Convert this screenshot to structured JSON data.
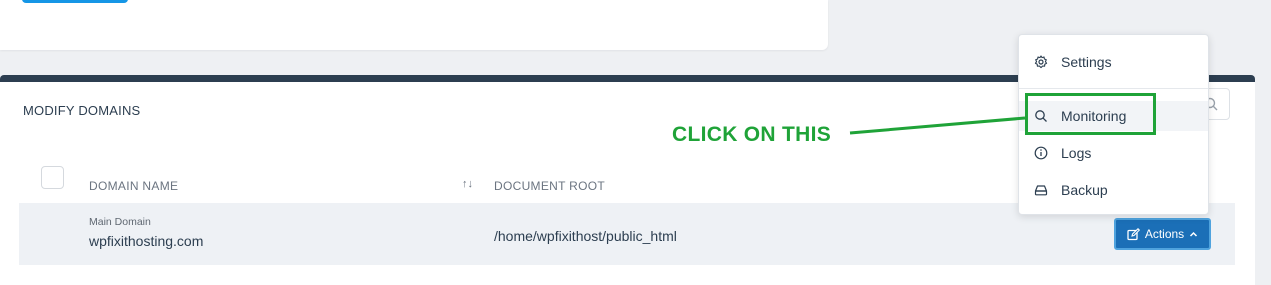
{
  "panel": {
    "title": "MODIFY DOMAINS"
  },
  "table": {
    "columns": {
      "domain_name": "DOMAIN NAME",
      "sort_glyph": "↑↓",
      "document_root": "DOCUMENT ROOT"
    },
    "rows": [
      {
        "label": "Main Domain",
        "domain": "wpfixithosting.com",
        "document_root": "/home/wpfixithost/public_html",
        "actions_label": "Actions"
      }
    ]
  },
  "menu": {
    "items": [
      {
        "label": "Settings",
        "icon": "gear-icon"
      },
      {
        "label": "Monitoring",
        "icon": "search-icon"
      },
      {
        "label": "Logs",
        "icon": "info-icon"
      },
      {
        "label": "Backup",
        "icon": "drive-icon"
      }
    ]
  },
  "annotation": {
    "callout_text": "CLICK ON THIS",
    "color": "#1fa338"
  },
  "colors": {
    "accent_button": "#1b6fb7",
    "panel_border": "#2c3e50",
    "top_button": "#1596e6"
  }
}
